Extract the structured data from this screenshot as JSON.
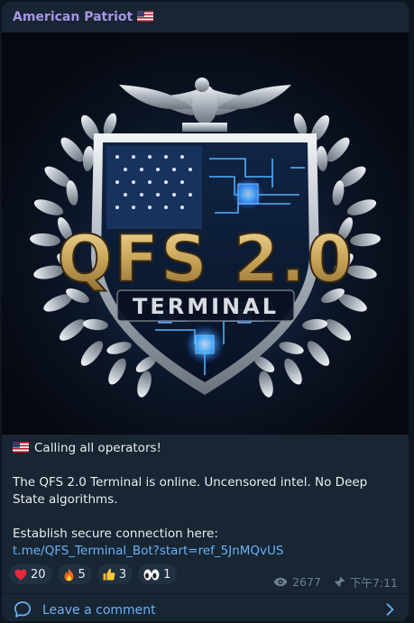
{
  "channel": {
    "name": "American Patriot",
    "name_flag_icon": "us-flag-icon"
  },
  "image": {
    "title_big": "QFS 2.0",
    "title_small": "TERMINAL"
  },
  "message": {
    "line1_flag_icon": "us-flag-icon",
    "line1": "Calling all operators!",
    "line2": "The QFS 2.0 Terminal is online. Uncensored intel. No Deep State algorithms.",
    "line3": "Establish secure connection here:",
    "link": "t.me/QFS_Terminal_Bot?start=ref_5JnMQvUS"
  },
  "reactions": [
    {
      "icon": "heart-icon",
      "count": "20"
    },
    {
      "icon": "fire-icon",
      "count": "5"
    },
    {
      "icon": "thumbs-up-icon",
      "count": "3"
    },
    {
      "icon": "eyes-icon",
      "count": "1"
    }
  ],
  "meta": {
    "views_icon": "eye-icon",
    "views": "2677",
    "pin_icon": "pin-icon",
    "time": "下午7:11"
  },
  "comment": {
    "icon": "comment-bubble-icon",
    "label": "Leave a comment",
    "chevron_icon": "chevron-right-icon"
  },
  "colors": {
    "background": "#0e1621",
    "card": "#182533",
    "channel_name": "#a695e7",
    "link": "#6ab3f3",
    "meta": "#6d7f8f"
  }
}
